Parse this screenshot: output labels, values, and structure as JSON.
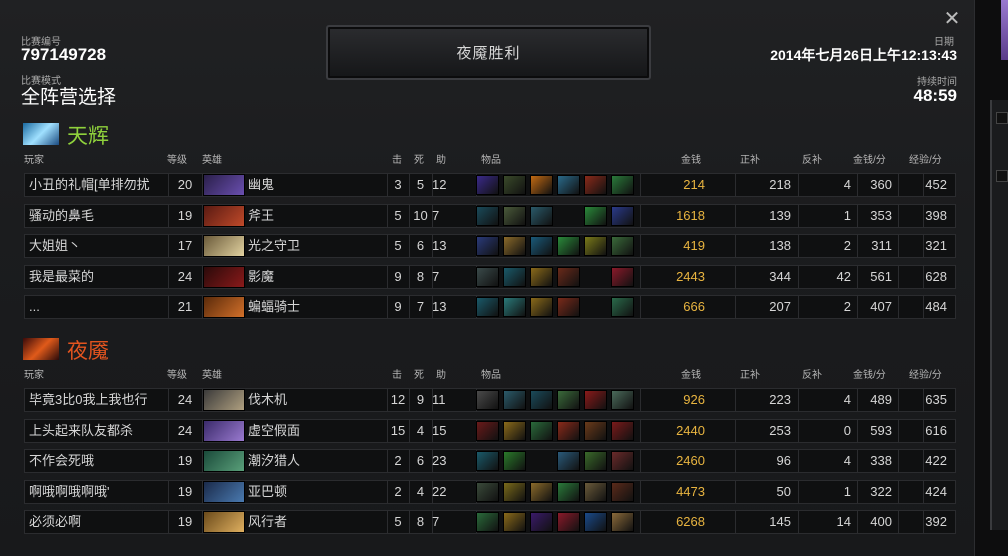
{
  "match": {
    "id_label": "比赛编号",
    "id_value": "797149728",
    "mode_label": "比赛模式",
    "mode_value": "全阵营选择",
    "result": "夜魇胜利",
    "date_label": "日期",
    "date_value": "2014年七月26日上午12:13:43",
    "duration_label": "持续时间",
    "duration_value": "48:59"
  },
  "close_icon": "close-icon",
  "columns": {
    "player": "玩家",
    "level": "等级",
    "hero": "英雄",
    "kills": "击",
    "deaths": "死",
    "assists": "助",
    "items": "物品",
    "gold": "金钱",
    "last_hits": "正补",
    "denies": "反补",
    "gpm": "金钱/分",
    "xpm": "经验/分"
  },
  "colors": {
    "radiant": "#8fd13c",
    "dire": "#e2541f",
    "gold": "#e8b440",
    "panel": "#1d1e20"
  },
  "teams": [
    {
      "name": "天辉",
      "players": [
        {
          "player": "小丑的礼帽[单排勿扰",
          "level": "20",
          "hero": "幽鬼",
          "k": "3",
          "d": "5",
          "a": "12",
          "gold": "214",
          "lh": "218",
          "dn": "4",
          "gpm": "360",
          "xpm": "452",
          "portrait": [
            "#2a1f4a",
            "#6a4fb0"
          ],
          "items": [
            "#3a2a8a",
            "#3a4a2a",
            "#c26a12",
            "#2a6a8a",
            "#8a2a1a",
            "#2a7a3a"
          ]
        },
        {
          "player": "骚动的鼻毛",
          "level": "19",
          "hero": "斧王",
          "k": "5",
          "d": "10",
          "a": "7",
          "gold": "1618",
          "lh": "139",
          "dn": "1",
          "gpm": "353",
          "xpm": "398",
          "portrait": [
            "#5a1a12",
            "#c04a2a"
          ],
          "items": [
            "#1a4a5a",
            "#4a5a3a",
            "#2a5a6a",
            "",
            "#2a8a3a",
            "#2a3a8a"
          ]
        },
        {
          "player": "大姐姐丶",
          "level": "17",
          "hero": "光之守卫",
          "k": "5",
          "d": "6",
          "a": "13",
          "gold": "419",
          "lh": "138",
          "dn": "2",
          "gpm": "311",
          "xpm": "321",
          "portrait": [
            "#6a5a3a",
            "#e2d2a0"
          ],
          "items": [
            "#2a3a7a",
            "#8a6a2a",
            "#1a5a7a",
            "#2a8a3a",
            "#7a7a1a",
            "#3a6a3a"
          ]
        },
        {
          "player": "我是最菜的",
          "level": "24",
          "hero": "影魔",
          "k": "9",
          "d": "8",
          "a": "7",
          "gold": "2443",
          "lh": "344",
          "dn": "42",
          "gpm": "561",
          "xpm": "628",
          "portrait": [
            "#2a0a0a",
            "#8a1a1a"
          ],
          "items": [
            "#3a4a4a",
            "#1a5a6a",
            "#8a6a1a",
            "#6a2a1a",
            "",
            "#8a1a2a"
          ]
        },
        {
          "player": "...",
          "level": "21",
          "hero": "蝙蝠骑士",
          "k": "9",
          "d": "7",
          "a": "13",
          "gold": "666",
          "lh": "207",
          "dn": "2",
          "gpm": "407",
          "xpm": "484",
          "portrait": [
            "#5a2a0a",
            "#d2702a"
          ],
          "items": [
            "#1a5a6a",
            "#2a7a7a",
            "#8a6a1a",
            "#7a2a1a",
            "",
            "#2a6a4a"
          ]
        }
      ]
    },
    {
      "name": "夜魇",
      "players": [
        {
          "player": "毕竟3比0我上我也行",
          "level": "24",
          "hero": "伐木机",
          "k": "12",
          "d": "9",
          "a": "11",
          "gold": "926",
          "lh": "223",
          "dn": "4",
          "gpm": "489",
          "xpm": "635",
          "portrait": [
            "#3a3a3a",
            "#b0a080"
          ],
          "items": [
            "#4a4a4a",
            "#2a5a6a",
            "#1a4a5a",
            "#3a6a3a",
            "#8a1a1a",
            "#4a6a5a"
          ]
        },
        {
          "player": "上头起来队友都杀",
          "level": "24",
          "hero": "虚空假面",
          "k": "15",
          "d": "4",
          "a": "15",
          "gold": "2440",
          "lh": "253",
          "dn": "0",
          "gpm": "593",
          "xpm": "616",
          "portrait": [
            "#3a2a6a",
            "#9a7ad0"
          ],
          "items": [
            "#6a1a1a",
            "#8a6a1a",
            "#2a6a3a",
            "#8a2a1a",
            "#6a3a1a",
            "#7a1a1a"
          ]
        },
        {
          "player": "不作会死哦",
          "level": "19",
          "hero": "潮汐猎人",
          "k": "2",
          "d": "6",
          "a": "23",
          "gold": "2460",
          "lh": "96",
          "dn": "4",
          "gpm": "338",
          "xpm": "422",
          "portrait": [
            "#1a4a3a",
            "#5aa07a"
          ],
          "items": [
            "#1a5a6a",
            "#2a7a2a",
            "",
            "#2a5a7a",
            "#3a6a2a",
            "#6a2a2a"
          ]
        },
        {
          "player": "啊哦啊哦啊哦'",
          "level": "19",
          "hero": "亚巴顿",
          "k": "2",
          "d": "4",
          "a": "22",
          "gold": "4473",
          "lh": "50",
          "dn": "1",
          "gpm": "322",
          "xpm": "424",
          "portrait": [
            "#1a2a4a",
            "#4a7ab0"
          ],
          "items": [
            "#3a4a3a",
            "#7a6a1a",
            "#8a6a2a",
            "#2a7a3a",
            "#6a5a3a",
            "#5a2a1a"
          ]
        },
        {
          "player": "必须必啊",
          "level": "19",
          "hero": "风行者",
          "k": "5",
          "d": "8",
          "a": "7",
          "gold": "6268",
          "lh": "145",
          "dn": "14",
          "gpm": "400",
          "xpm": "392",
          "portrait": [
            "#6a4a1a",
            "#e0b060"
          ],
          "items": [
            "#2a6a3a",
            "#8a6a1a",
            "#3a1a6a",
            "#8a1a2a",
            "#1a4a8a",
            "#8a6a3a"
          ]
        }
      ]
    }
  ]
}
